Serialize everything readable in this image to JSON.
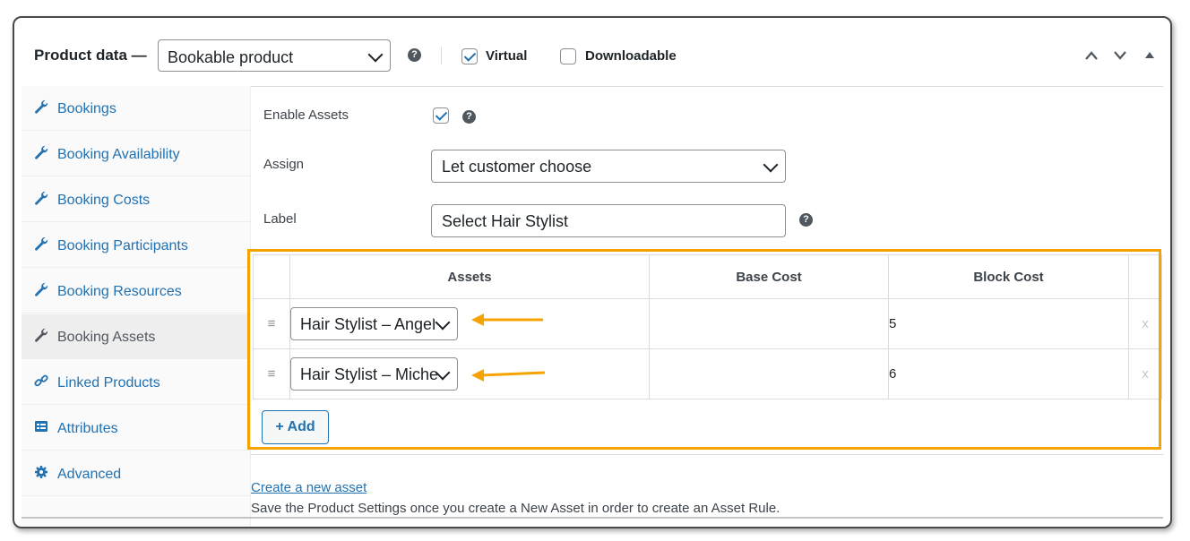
{
  "header": {
    "title": "Product data —",
    "product_type": "Bookable product",
    "virtual_label": "Virtual",
    "virtual_checked": true,
    "downloadable_label": "Downloadable",
    "downloadable_checked": false,
    "help_glyph": "?"
  },
  "sidebar": {
    "items": [
      {
        "label": "Bookings",
        "icon": "wrench-icon"
      },
      {
        "label": "Booking Availability",
        "icon": "wrench-icon"
      },
      {
        "label": "Booking Costs",
        "icon": "wrench-icon"
      },
      {
        "label": "Booking Participants",
        "icon": "wrench-icon"
      },
      {
        "label": "Booking Resources",
        "icon": "wrench-icon"
      },
      {
        "label": "Booking Assets",
        "icon": "wrench-icon",
        "active": true
      },
      {
        "label": "Linked Products",
        "icon": "link-icon"
      },
      {
        "label": "Attributes",
        "icon": "list-icon"
      },
      {
        "label": "Advanced",
        "icon": "gear-icon"
      }
    ]
  },
  "form": {
    "enable_assets_label": "Enable Assets",
    "enable_assets_checked": true,
    "assign_label": "Assign",
    "assign_value": "Let customer choose",
    "label_label": "Label",
    "label_value": "Select Hair Stylist"
  },
  "assets_table": {
    "headers": [
      "Assets",
      "Base Cost",
      "Block Cost"
    ],
    "rows": [
      {
        "asset": "Hair Stylist – Angel",
        "base_cost": "",
        "block_cost": "5",
        "remove": "x"
      },
      {
        "asset": "Hair Stylist – Miche",
        "base_cost": "",
        "block_cost": "6",
        "remove": "x"
      }
    ],
    "add_label": "+ Add"
  },
  "footer": {
    "create_link": "Create a new asset",
    "note": "Save the Product Settings once you create a New Asset in order to create an Asset Rule."
  },
  "colors": {
    "highlight": "#f5a300",
    "link": "#2271b1",
    "arrow": "#f5a300"
  }
}
